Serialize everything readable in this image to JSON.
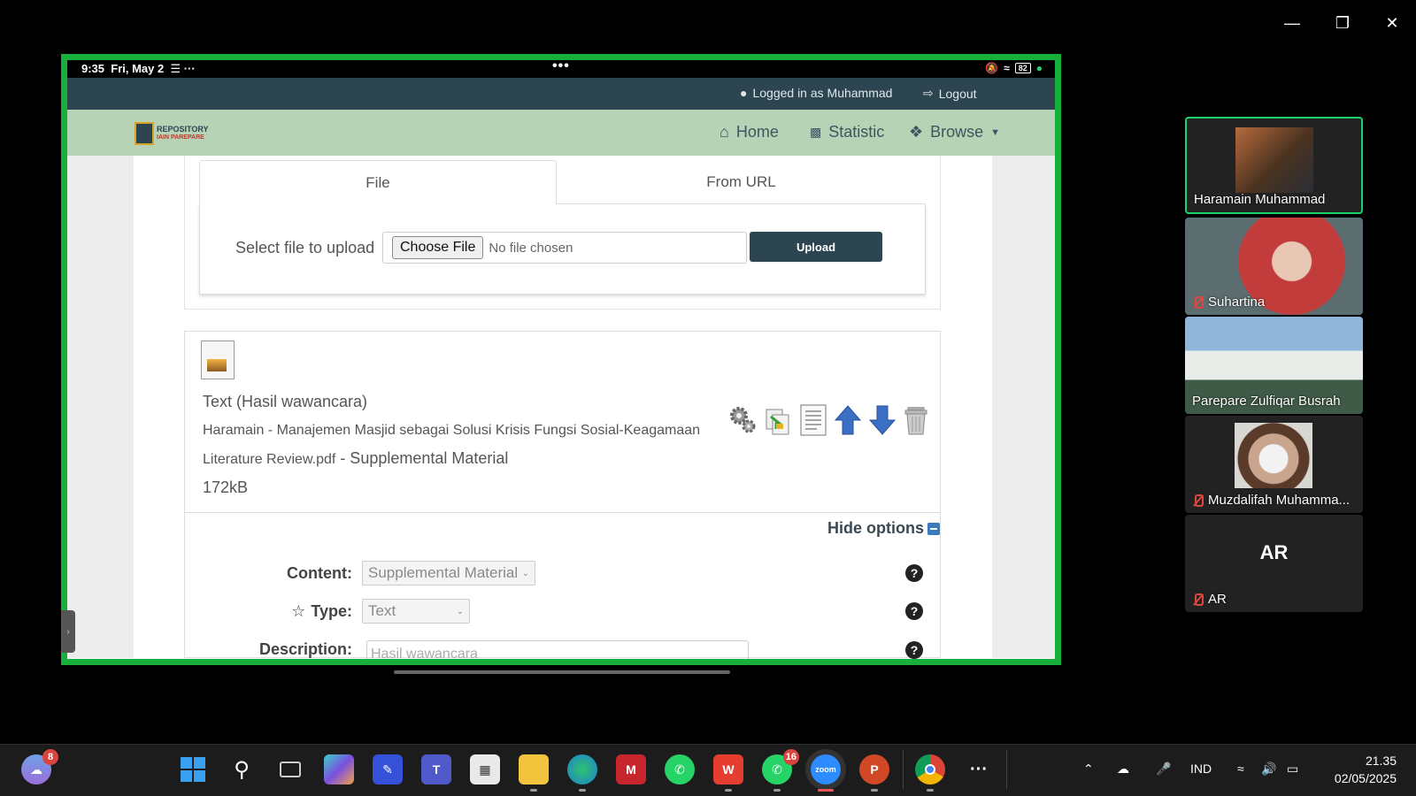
{
  "status_bar": {
    "time": "9:35",
    "date": "Fri, May 2",
    "battery": "82"
  },
  "user_bar": {
    "logged_in": "Logged in as Muhammad",
    "logout": "Logout"
  },
  "nav": {
    "home": "Home",
    "statistic": "Statistic",
    "browse": "Browse"
  },
  "logo": {
    "line1": "REPOSITORY",
    "line2": "IAIN PAREPARE"
  },
  "upload": {
    "tab_file": "File",
    "tab_url": "From URL",
    "select_label": "Select file to upload",
    "choose_button": "Choose File",
    "no_file": "No file chosen",
    "upload_button": "Upload"
  },
  "document": {
    "type_line": "Text (Hasil wawancara)",
    "filename_line1": "Haramain - Manajemen Masjid sebagai Solusi Krisis Fungsi Sosial-Keagamaan",
    "filename_line2": "Literature Review.pdf",
    "content_suffix": " - Supplemental Material",
    "size": "172kB",
    "hide_options": "Hide options"
  },
  "options": {
    "content_label": "Content:",
    "content_value": "Supplemental Material",
    "type_label": "Type:",
    "type_value": "Text",
    "description_label": "Description:",
    "description_value": "Hasil wawancara"
  },
  "participants": [
    {
      "name": "Haramain Muhammad"
    },
    {
      "name": "Suhartina"
    },
    {
      "name": "Parepare Zulfiqar Busrah"
    },
    {
      "name": "Muzdalifah Muhamma..."
    },
    {
      "name": "AR",
      "initials": "AR"
    }
  ],
  "taskbar": {
    "weather_badge": "8",
    "whatsapp_badge": "16",
    "language": "IND",
    "time": "21.35",
    "date": "02/05/2025"
  }
}
